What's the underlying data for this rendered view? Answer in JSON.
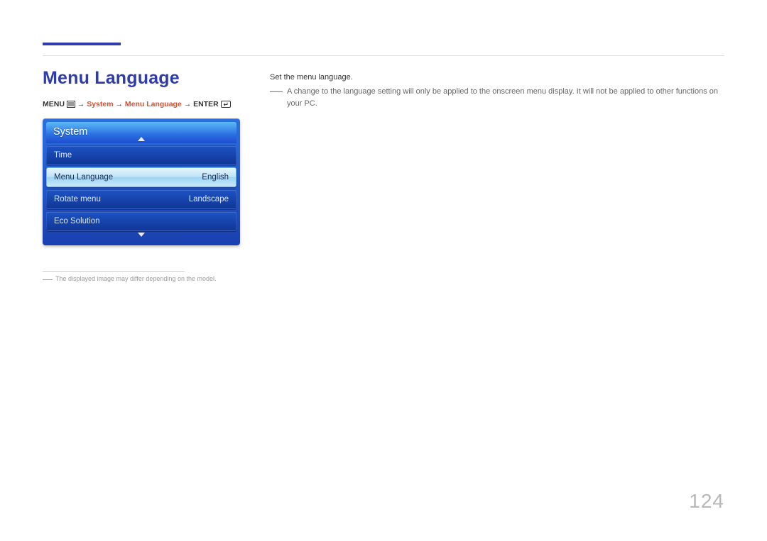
{
  "page": {
    "title": "Menu Language",
    "number": "124"
  },
  "breadcrumb": {
    "menu_label": "MENU",
    "arrow": "→",
    "system": "System",
    "menu_language": "Menu Language",
    "enter_label": "ENTER"
  },
  "osd": {
    "header": "System",
    "items": [
      {
        "label": "Time",
        "value": "",
        "selected": false
      },
      {
        "label": "Menu Language",
        "value": "English",
        "selected": true
      },
      {
        "label": "Rotate menu",
        "value": "Landscape",
        "selected": false
      },
      {
        "label": "Eco Solution",
        "value": "",
        "selected": false
      }
    ]
  },
  "footnote": "The displayed image may differ depending on the model.",
  "description": {
    "main": "Set the menu language.",
    "note": "A change to the language setting will only be applied to the onscreen menu display. It will not be applied to other functions on your PC."
  }
}
